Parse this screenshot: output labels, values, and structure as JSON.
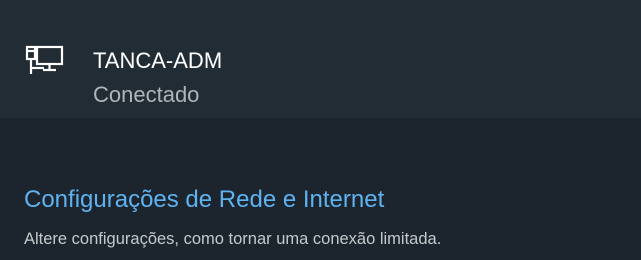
{
  "network": {
    "icon": "wired-network-icon",
    "name": "TANCA-ADM",
    "status": "Conectado"
  },
  "settings": {
    "link_label": "Configurações de Rede e Internet",
    "description": "Altere configurações, como tornar uma conexão limitada."
  },
  "colors": {
    "background": "#1c252d",
    "item_background": "#222c34",
    "link": "#5fb2f0",
    "primary_text": "#ffffff",
    "secondary_text": "#aeb5ba"
  }
}
